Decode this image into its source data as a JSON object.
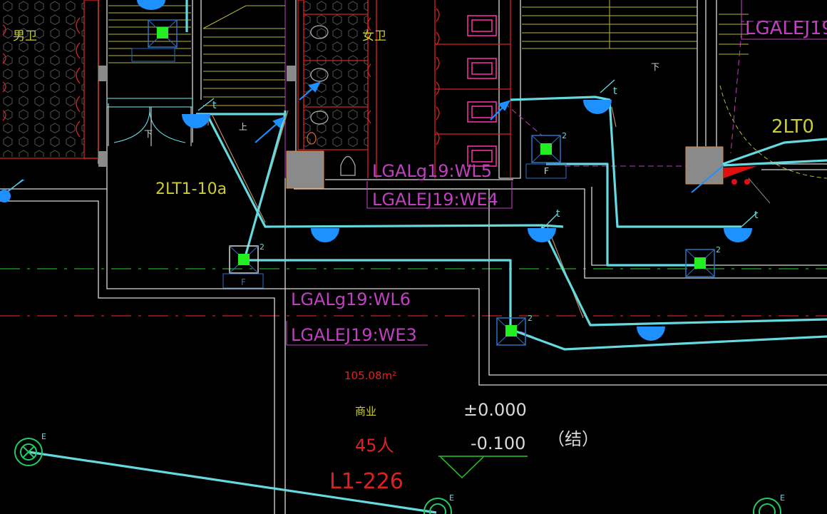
{
  "drawing": {
    "tags": {
      "panel_2lt1": "2LT1-10a",
      "panel_2lt_right": "2LT0",
      "room_left": "男卫",
      "room_middle": "女卫",
      "room_main": "商业"
    },
    "circuits": {
      "wl5": "LGALg19:WL5",
      "we4": "LGALEJ19:WE4",
      "wl6": "LGALg19:WL6",
      "we3": "LGALEJ19:WE3",
      "top_right": "LGALEJ19"
    },
    "room_info": {
      "area": "105.08m²",
      "occupancy": "45人",
      "room_id": "L1-226"
    },
    "elevations": {
      "finish": "±0.000",
      "structure": "-0.100",
      "structure_note": "（结）"
    },
    "fixture_marks": {
      "t": "t",
      "e": "E",
      "two": "2",
      "f": "F",
      "down": "下",
      "up": "上"
    },
    "colors": {
      "background": "#000000",
      "wiring": "#66d9df",
      "wall": "#d9d9d9",
      "circuit_label": "#c040c0",
      "panel_text": "#cccc33",
      "room_text": "#e02020",
      "fixture_blue": "#1e90ff",
      "fixture_green": "#22ee22",
      "toilet_red": "#dd2222",
      "magenta": "#ff33aa",
      "grid_green": "#22aa22",
      "grid_red": "#cc2222"
    }
  }
}
